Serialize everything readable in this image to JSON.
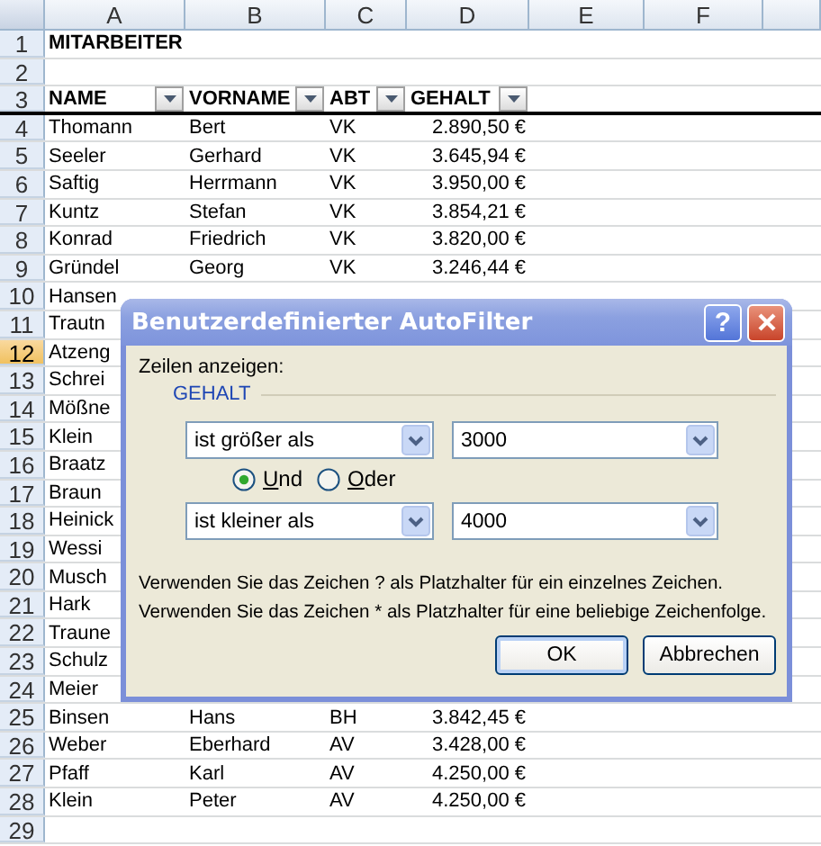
{
  "sheet": {
    "columns": [
      "A",
      "B",
      "C",
      "D",
      "E",
      "F"
    ],
    "rows": [
      {
        "number": "1",
        "selected": false,
        "kind": "title",
        "cells": [
          "MITARBEITER"
        ]
      },
      {
        "number": "2",
        "selected": false,
        "kind": "empty",
        "cells": []
      },
      {
        "number": "3",
        "selected": false,
        "kind": "header",
        "cells": [
          "NAME",
          "VORNAME",
          "ABT",
          "GEHALT"
        ]
      },
      {
        "number": "4",
        "selected": false,
        "kind": "data",
        "cells": [
          "Thomann",
          "Bert",
          "VK",
          "2.890,50 €"
        ]
      },
      {
        "number": "5",
        "selected": false,
        "kind": "data",
        "cells": [
          "Seeler",
          "Gerhard",
          "VK",
          "3.645,94 €"
        ]
      },
      {
        "number": "6",
        "selected": false,
        "kind": "data",
        "cells": [
          "Saftig",
          "Herrmann",
          "VK",
          "3.950,00 €"
        ]
      },
      {
        "number": "7",
        "selected": false,
        "kind": "data",
        "cells": [
          "Kuntz",
          "Stefan",
          "VK",
          "3.854,21 €"
        ]
      },
      {
        "number": "8",
        "selected": false,
        "kind": "data",
        "cells": [
          "Konrad",
          "Friedrich",
          "VK",
          "3.820,00 €"
        ]
      },
      {
        "number": "9",
        "selected": false,
        "kind": "data",
        "cells": [
          "Gründel",
          "Georg",
          "VK",
          "3.246,44 €"
        ]
      },
      {
        "number": "10",
        "selected": false,
        "kind": "data",
        "cells": [
          "Hansen"
        ]
      },
      {
        "number": "11",
        "selected": false,
        "kind": "data",
        "cells": [
          "Trautn"
        ]
      },
      {
        "number": "12",
        "selected": true,
        "kind": "data",
        "cells": [
          "Atzeng"
        ]
      },
      {
        "number": "13",
        "selected": false,
        "kind": "data",
        "cells": [
          "Schrei"
        ]
      },
      {
        "number": "14",
        "selected": false,
        "kind": "data",
        "cells": [
          "Mößne"
        ]
      },
      {
        "number": "15",
        "selected": false,
        "kind": "data",
        "cells": [
          "Klein"
        ]
      },
      {
        "number": "16",
        "selected": false,
        "kind": "data",
        "cells": [
          "Braatz"
        ]
      },
      {
        "number": "17",
        "selected": false,
        "kind": "data",
        "cells": [
          "Braun"
        ]
      },
      {
        "number": "18",
        "selected": false,
        "kind": "data",
        "cells": [
          "Heinick"
        ]
      },
      {
        "number": "19",
        "selected": false,
        "kind": "data",
        "cells": [
          "Wessi"
        ]
      },
      {
        "number": "20",
        "selected": false,
        "kind": "data",
        "cells": [
          "Musch"
        ]
      },
      {
        "number": "21",
        "selected": false,
        "kind": "data",
        "cells": [
          "Hark"
        ]
      },
      {
        "number": "22",
        "selected": false,
        "kind": "data",
        "cells": [
          "Traune"
        ]
      },
      {
        "number": "23",
        "selected": false,
        "kind": "data",
        "cells": [
          "Schulz"
        ]
      },
      {
        "number": "24",
        "selected": false,
        "kind": "data",
        "cells": [
          "Meier"
        ]
      },
      {
        "number": "25",
        "selected": false,
        "kind": "data",
        "cells": [
          "Binsen",
          "Hans",
          "BH",
          "3.842,45 €"
        ]
      },
      {
        "number": "26",
        "selected": false,
        "kind": "data",
        "cells": [
          "Weber",
          "Eberhard",
          "AV",
          "3.428,00 €"
        ]
      },
      {
        "number": "27",
        "selected": false,
        "kind": "data",
        "cells": [
          "Pfaff",
          "Karl",
          "AV",
          "4.250,00 €"
        ]
      },
      {
        "number": "28",
        "selected": false,
        "kind": "data",
        "cells": [
          "Klein",
          "Peter",
          "AV",
          "4.250,00 €"
        ]
      },
      {
        "number": "29",
        "selected": false,
        "kind": "empty",
        "cells": []
      }
    ]
  },
  "dialog": {
    "title": "Benutzerdefinierter AutoFilter",
    "help": "?",
    "prompt": "Zeilen anzeigen:",
    "group": "GEHALT",
    "conditions": [
      {
        "operator": "ist größer als",
        "value": "3000"
      },
      {
        "operator": "ist kleiner als",
        "value": "4000"
      }
    ],
    "radios": [
      {
        "label": "Und",
        "selected": true
      },
      {
        "label": "Oder",
        "selected": false
      }
    ],
    "hints": [
      "Verwenden Sie das Zeichen ? als Platzhalter für ein einzelnes Zeichen.",
      "Verwenden Sie das Zeichen * als Platzhalter für eine beliebige Zeichenfolge."
    ],
    "buttons": [
      {
        "label": "OK",
        "default": true
      },
      {
        "label": "Abbrechen",
        "default": false
      }
    ]
  }
}
